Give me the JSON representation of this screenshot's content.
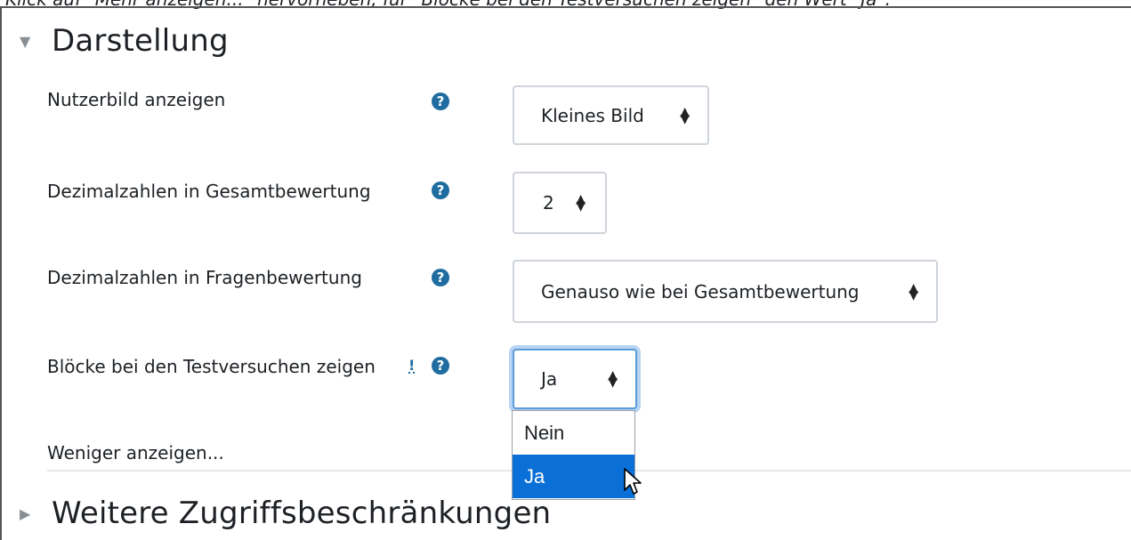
{
  "caption": "Klick auf \"Mehr anzeigen...\" hervorheben, für \"Blöcke bei den Testversuchen zeigen\" den Wert \"Ja\".",
  "sections": {
    "darstellung": {
      "title": "Darstellung",
      "expanded": true
    },
    "weitere": {
      "title": "Weitere Zugriffsbeschränkungen",
      "expanded": false
    }
  },
  "fields": [
    {
      "label": "Nutzerbild anzeigen",
      "value": "Kleines Bild",
      "advanced": false
    },
    {
      "label": "Dezimalzahlen in Gesamtbewertung",
      "value": "2",
      "advanced": false
    },
    {
      "label": "Dezimalzahlen in Fragenbewertung",
      "value": "Genauso wie bei Gesamtbewertung",
      "advanced": false
    },
    {
      "label": "Blöcke bei den Testversuchen zeigen",
      "value": "Ja",
      "advanced": true,
      "advanced_marker": "!"
    }
  ],
  "help_icon_text": "?",
  "dropdown": {
    "options": [
      "Nein",
      "Ja"
    ],
    "selected": "Ja"
  },
  "less_link": "Weniger anzeigen...",
  "colors": {
    "help_icon": "#1f6ca0",
    "focus_ring": "#b7d3f3",
    "selected_option": "#0a6fd6"
  }
}
